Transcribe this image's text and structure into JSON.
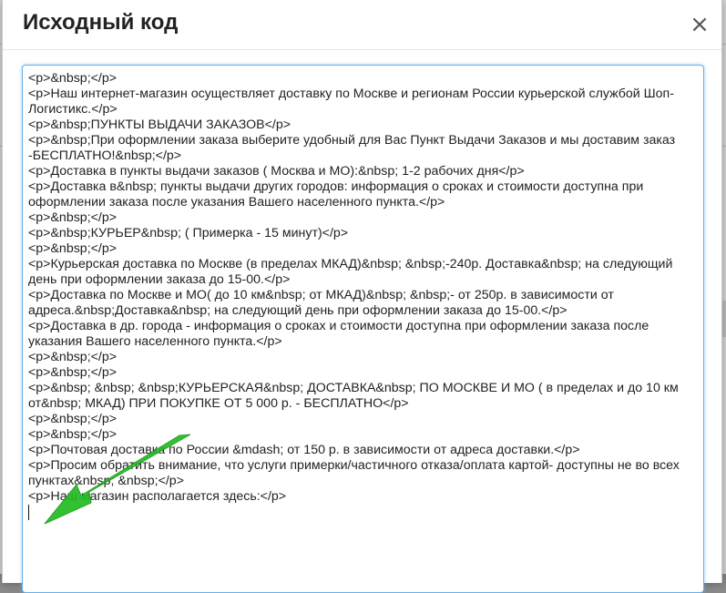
{
  "modal": {
    "title": "Исходный код",
    "close_icon": "close-icon",
    "close_glyph": "×"
  },
  "editor": {
    "lines": [
      "<p>&nbsp;</p>",
      "<p>Наш интернет-магазин осуществляет доставку по Москве и регионам России курьерской службой Шоп-Логистикс.</p>",
      "<p>&nbsp;ПУНКТЫ ВЫДАЧИ ЗАКАЗОВ</p>",
      "<p>&nbsp;При оформлении заказа выберите удобный для Вас Пункт Выдачи Заказов и мы доставим заказ -БЕСПЛАТНО!&nbsp;</p>",
      "<p>Доставка в пункты выдачи заказов ( Москва и МО):&nbsp; 1-2 рабочих дня</p>",
      "<p>Доставка в&nbsp; пункты выдачи других городов: информация о сроках и стоимости доступна при оформлении заказа после указания Вашего населенного пункта.</p>",
      "<p>&nbsp;</p>",
      "<p>&nbsp;КУРЬЕР&nbsp; ( Примерка - 15 минут)</p>",
      "<p>&nbsp;</p>",
      "<p>Курьерская доставка по Москве (в пределах МКАД)&nbsp; &nbsp;-240р. Доставка&nbsp; на следующий день при оформлении заказа до 15-00.</p>",
      "<p>Доставка по Москве и МО( до 10 км&nbsp; от МКАД)&nbsp; &nbsp;- от 250р. в зависимости от адреса.&nbsp;Доставка&nbsp; на следующий день при оформлении заказа до 15-00.</p>",
      "<p>Доставка в др. города - информация о сроках и стоимости доступна при оформлении заказа после указания Вашего населенного пункта.</p>",
      "<p>&nbsp;</p>",
      "<p>&nbsp;</p>",
      "<p>&nbsp; &nbsp; &nbsp;КУРЬЕРСКАЯ&nbsp; ДОСТАВКА&nbsp; ПО МОСКВЕ И МО ( в пределах и до 10 км от&nbsp; МКАД) ПРИ ПОКУПКЕ ОТ 5 000 р. - БЕСПЛАТНО</p>",
      "<p>&nbsp;</p>",
      "<p>&nbsp;</p>",
      "<p>Почтовая доставка по России &mdash; от 150 р. в зависимости от адреса доставки.</p>",
      "<p>Просим обратить внимание, что услуги примерки/частичного отказа/оплата картой- доступны не во всех пунктах&nbsp; &nbsp;</p>",
      "<p>Наш магазин располагается здесь:</p>"
    ]
  },
  "annotation": {
    "arrow_color": "#22bb22",
    "arrow_icon": "green-arrow-icon"
  },
  "colors": {
    "focus_border": "#66afe9",
    "text": "#222222"
  }
}
